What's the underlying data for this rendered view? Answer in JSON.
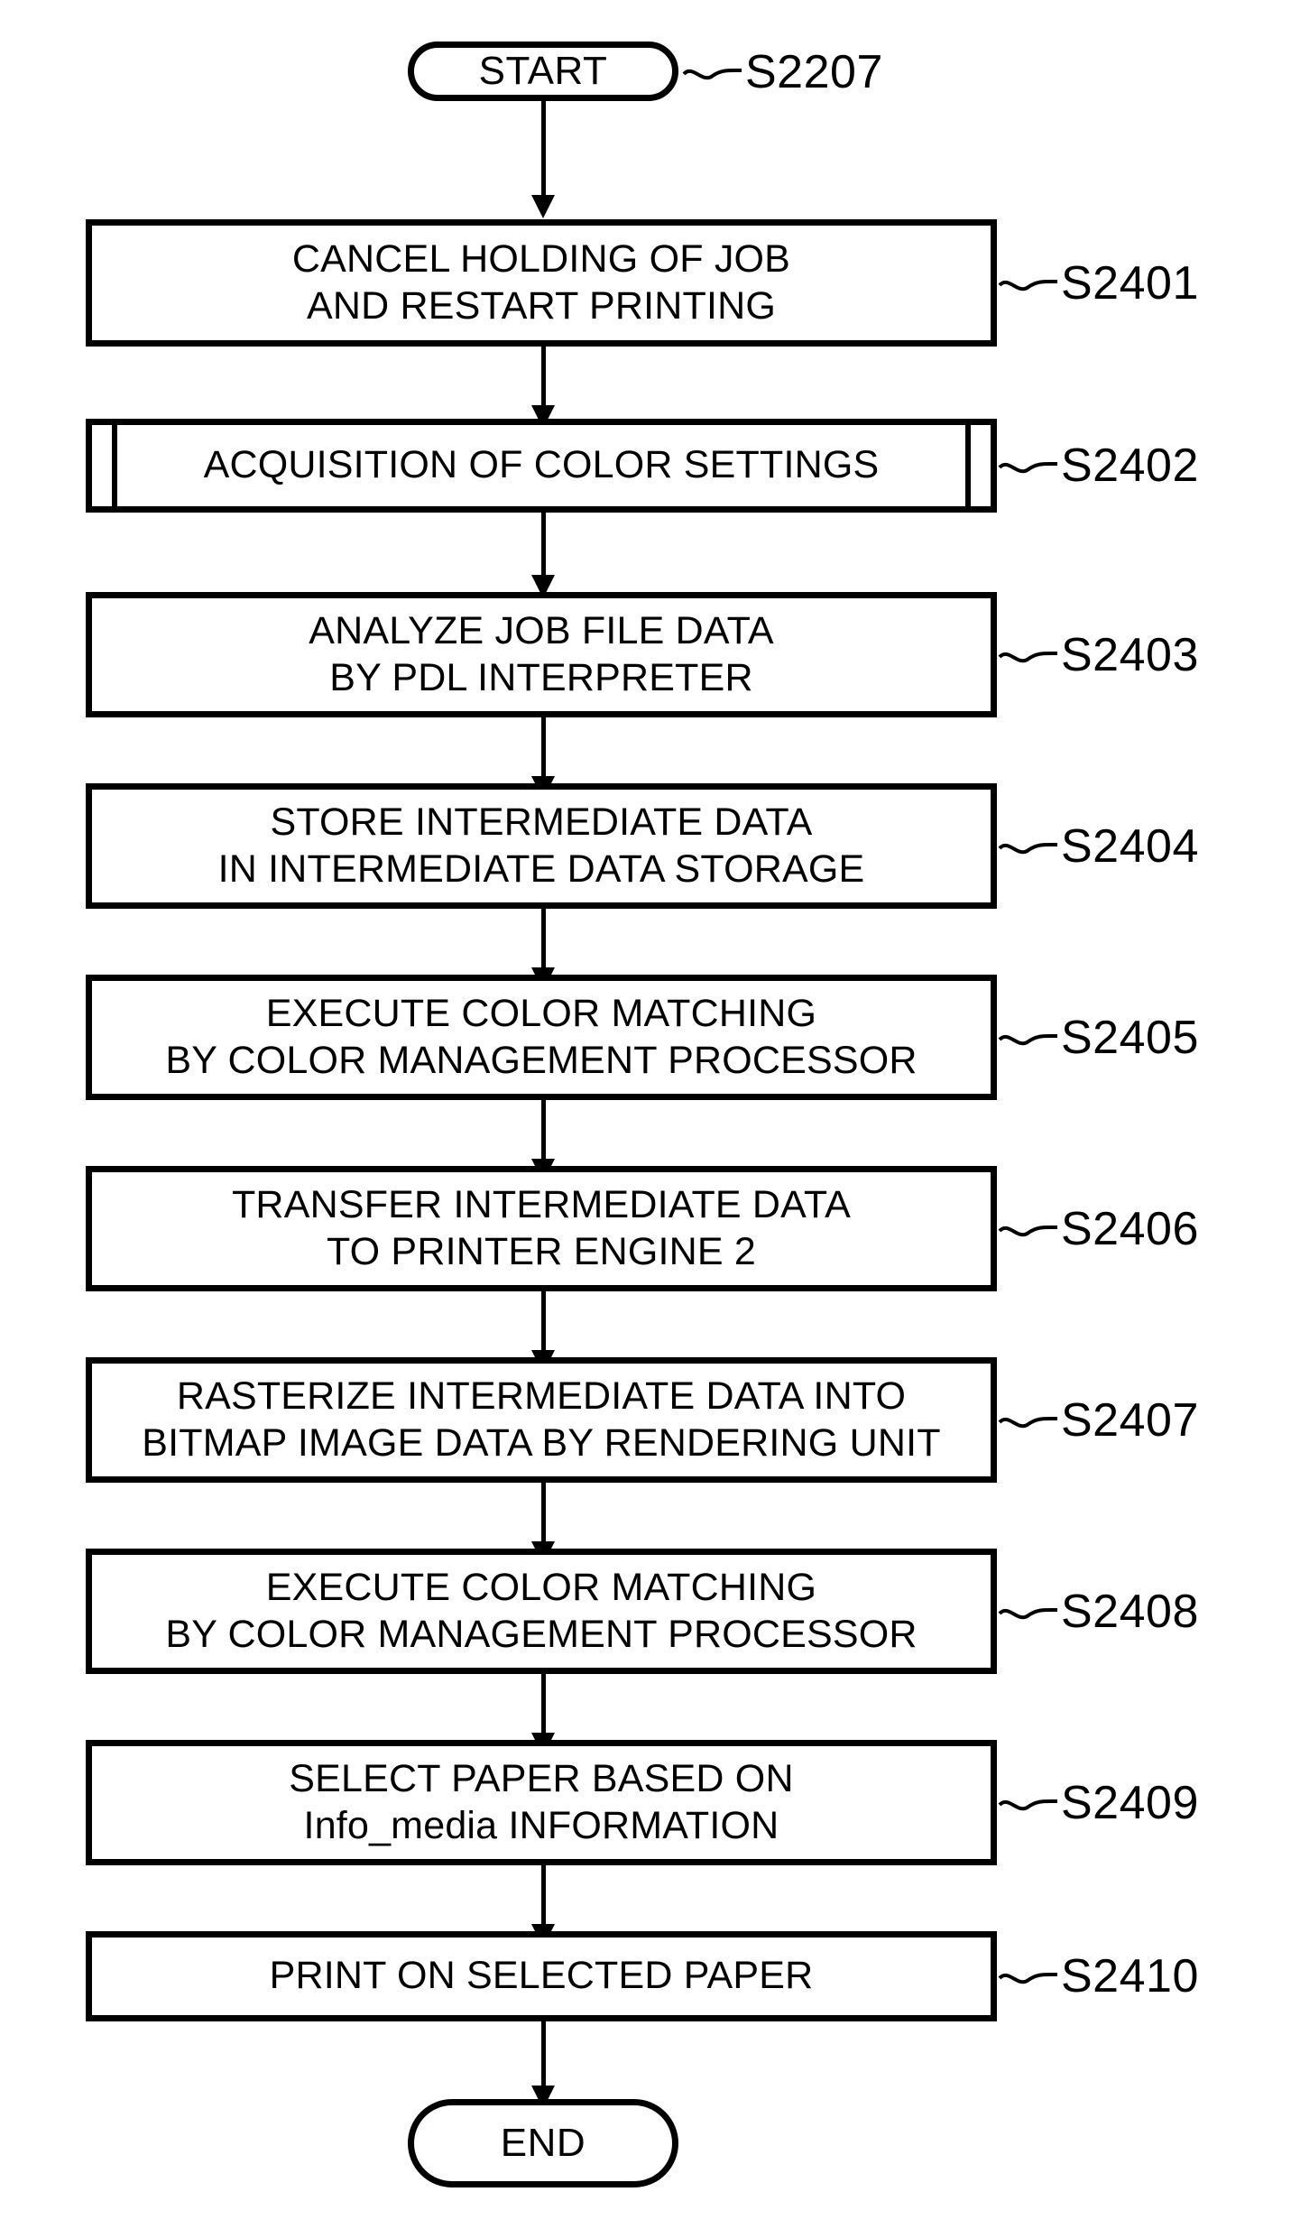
{
  "diagram": {
    "type": "flowchart",
    "orientation": "vertical",
    "colors": {
      "stroke": "#000000",
      "fill": "#ffffff",
      "text": "#000000",
      "background": "#ffffff"
    },
    "start": {
      "label": "START",
      "shape": "terminator",
      "ref": "S2207"
    },
    "end": {
      "label": "END",
      "shape": "terminator"
    },
    "steps": [
      {
        "ref": "S2401",
        "shape": "process",
        "lines": [
          "CANCEL HOLDING OF JOB",
          "AND RESTART PRINTING"
        ],
        "text": "CANCEL HOLDING OF JOB\nAND RESTART PRINTING"
      },
      {
        "ref": "S2402",
        "shape": "predefined-process",
        "lines": [
          "ACQUISITION OF COLOR SETTINGS"
        ],
        "text": "ACQUISITION OF COLOR SETTINGS"
      },
      {
        "ref": "S2403",
        "shape": "process",
        "lines": [
          "ANALYZE JOB FILE DATA",
          "BY PDL INTERPRETER"
        ],
        "text": "ANALYZE JOB FILE DATA\nBY PDL INTERPRETER"
      },
      {
        "ref": "S2404",
        "shape": "process",
        "lines": [
          "STORE INTERMEDIATE DATA",
          "IN INTERMEDIATE DATA STORAGE"
        ],
        "text": "STORE INTERMEDIATE DATA\nIN INTERMEDIATE DATA STORAGE"
      },
      {
        "ref": "S2405",
        "shape": "process",
        "lines": [
          "EXECUTE COLOR MATCHING",
          "BY COLOR MANAGEMENT PROCESSOR"
        ],
        "text": "EXECUTE COLOR MATCHING\nBY COLOR MANAGEMENT PROCESSOR"
      },
      {
        "ref": "S2406",
        "shape": "process",
        "lines": [
          "TRANSFER INTERMEDIATE DATA",
          "TO PRINTER ENGINE 2"
        ],
        "text": "TRANSFER INTERMEDIATE DATA\nTO PRINTER ENGINE 2"
      },
      {
        "ref": "S2407",
        "shape": "process",
        "lines": [
          "RASTERIZE INTERMEDIATE DATA INTO",
          "BITMAP IMAGE DATA BY RENDERING UNIT"
        ],
        "text": "RASTERIZE INTERMEDIATE DATA INTO\nBITMAP IMAGE DATA BY RENDERING UNIT"
      },
      {
        "ref": "S2408",
        "shape": "process",
        "lines": [
          "EXECUTE COLOR MATCHING",
          "BY COLOR MANAGEMENT PROCESSOR"
        ],
        "text": "EXECUTE COLOR MATCHING\nBY COLOR MANAGEMENT PROCESSOR"
      },
      {
        "ref": "S2409",
        "shape": "process",
        "lines": [
          "SELECT PAPER BASED ON",
          "Info_media INFORMATION"
        ],
        "text": "SELECT PAPER BASED ON\nInfo_media INFORMATION"
      },
      {
        "ref": "S2410",
        "shape": "process",
        "lines": [
          "PRINT ON SELECTED PAPER"
        ],
        "text": "PRINT ON SELECTED PAPER"
      }
    ]
  }
}
